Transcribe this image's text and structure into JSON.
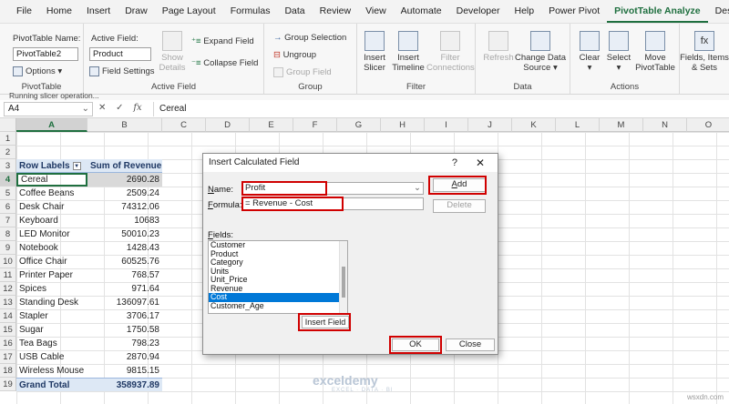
{
  "menu": {
    "tabs": [
      "File",
      "Home",
      "Insert",
      "Draw",
      "Page Layout",
      "Formulas",
      "Data",
      "Review",
      "View",
      "Automate",
      "Developer",
      "Help",
      "Power Pivot",
      "PivotTable Analyze",
      "Design"
    ],
    "active_tab": "PivotTable Analyze"
  },
  "ribbon": {
    "pivottable": {
      "name_label": "PivotTable Name:",
      "name_value": "PivotTable2",
      "options_label": "Options",
      "group_title": "PivotTable"
    },
    "active_field": {
      "label": "Active Field:",
      "value": "Product",
      "field_settings": "Field Settings",
      "show_details_1": "Show",
      "show_details_2": "Details",
      "expand": "Expand Field",
      "collapse": "Collapse Field",
      "group_title": "Active Field"
    },
    "group": {
      "group_selection": "Group Selection",
      "ungroup": "Ungroup",
      "group_field": "Group Field",
      "group_title": "Group"
    },
    "filter": {
      "insert_slicer_1": "Insert",
      "insert_slicer_2": "Slicer",
      "insert_timeline_1": "Insert",
      "insert_timeline_2": "Timeline",
      "filter_conn_1": "Filter",
      "filter_conn_2": "Connections",
      "group_title": "Filter"
    },
    "data": {
      "refresh": "Refresh",
      "change_source_1": "Change Data",
      "change_source_2": "Source",
      "group_title": "Data"
    },
    "actions": {
      "clear": "Clear",
      "select": "Select",
      "move_1": "Move",
      "move_2": "PivotTable",
      "group_title": "Actions"
    },
    "calculations": {
      "fields_1": "Fields, Items",
      "fields_2": "& Sets"
    }
  },
  "status_strip": "Running slicer operation...",
  "formula_bar": {
    "name_box": "A4",
    "cancel": "✕",
    "enter": "✓",
    "fx": "fx",
    "content": "Cereal"
  },
  "columns": [
    "A",
    "B",
    "C",
    "D",
    "E",
    "F",
    "G",
    "H",
    "I",
    "J",
    "K",
    "L",
    "M",
    "N",
    "O"
  ],
  "rows": [
    "1",
    "2",
    "3",
    "4",
    "5",
    "6",
    "7",
    "8",
    "9",
    "10",
    "11",
    "12",
    "13",
    "14",
    "15",
    "16",
    "17",
    "18",
    "19"
  ],
  "pivot": {
    "row_labels": "Row Labels",
    "sum_header": "Sum of Revenue",
    "items": [
      {
        "label": "Cereal",
        "value": "2690.28"
      },
      {
        "label": "Coffee Beans",
        "value": "2509.24"
      },
      {
        "label": "Desk Chair",
        "value": "74312.06"
      },
      {
        "label": "Keyboard",
        "value": "10683"
      },
      {
        "label": "LED Monitor",
        "value": "50010.23"
      },
      {
        "label": "Notebook",
        "value": "1428.43"
      },
      {
        "label": "Office Chair",
        "value": "60525.76"
      },
      {
        "label": "Printer Paper",
        "value": "768.57"
      },
      {
        "label": "Spices",
        "value": "971.64"
      },
      {
        "label": "Standing Desk",
        "value": "136097.61"
      },
      {
        "label": "Stapler",
        "value": "3706.17"
      },
      {
        "label": "Sugar",
        "value": "1750.58"
      },
      {
        "label": "Tea Bags",
        "value": "798.23"
      },
      {
        "label": "USB Cable",
        "value": "2870.94"
      },
      {
        "label": "Wireless Mouse",
        "value": "9815.15"
      }
    ],
    "grand_total_label": "Grand Total",
    "grand_total_value": "358937.89"
  },
  "dialog": {
    "title": "Insert Calculated Field",
    "help": "?",
    "close": "✕",
    "name_label": "Name:",
    "name_value": "Profit",
    "formula_label": "Formula:",
    "formula_value": "= Revenue - Cost",
    "fields_label": "Fields:",
    "fields": [
      "Customer",
      "Product",
      "Category",
      "Units",
      "Unit_Price",
      "Revenue",
      "Cost",
      "Customer_Age"
    ],
    "selected_field": "Cost",
    "add_button": "Add",
    "delete_button": "Delete",
    "insert_field_button": "Insert Field",
    "ok_button": "OK",
    "close_button": "Close"
  },
  "watermark": {
    "logo": "exceldemy",
    "tagline": "EXCEL · DATA · BI",
    "site": "wsxdn.com"
  },
  "colors": {
    "excel_green": "#1f6f3f",
    "highlight_red": "#d00000",
    "pivot_header_bg": "#dde8f5",
    "selection_blue": "#0078d7"
  }
}
